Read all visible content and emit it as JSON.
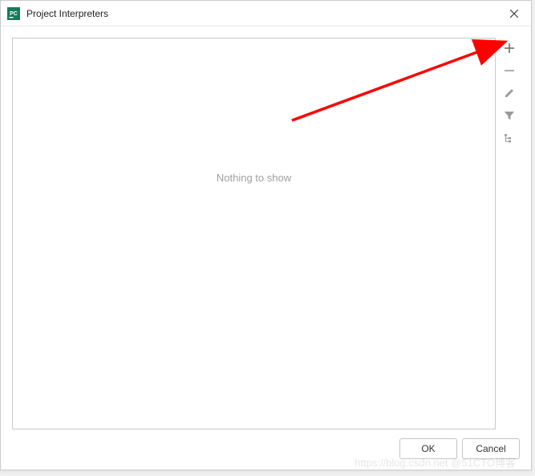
{
  "titlebar": {
    "title": "Project Interpreters"
  },
  "main": {
    "empty_text": "Nothing to show"
  },
  "toolbar": {
    "add": "",
    "remove": "",
    "edit": "",
    "filter": "",
    "show_paths": ""
  },
  "buttons": {
    "ok": "OK",
    "cancel": "Cancel"
  },
  "watermark": "https://blog.csdn.net  @51CTO博客"
}
